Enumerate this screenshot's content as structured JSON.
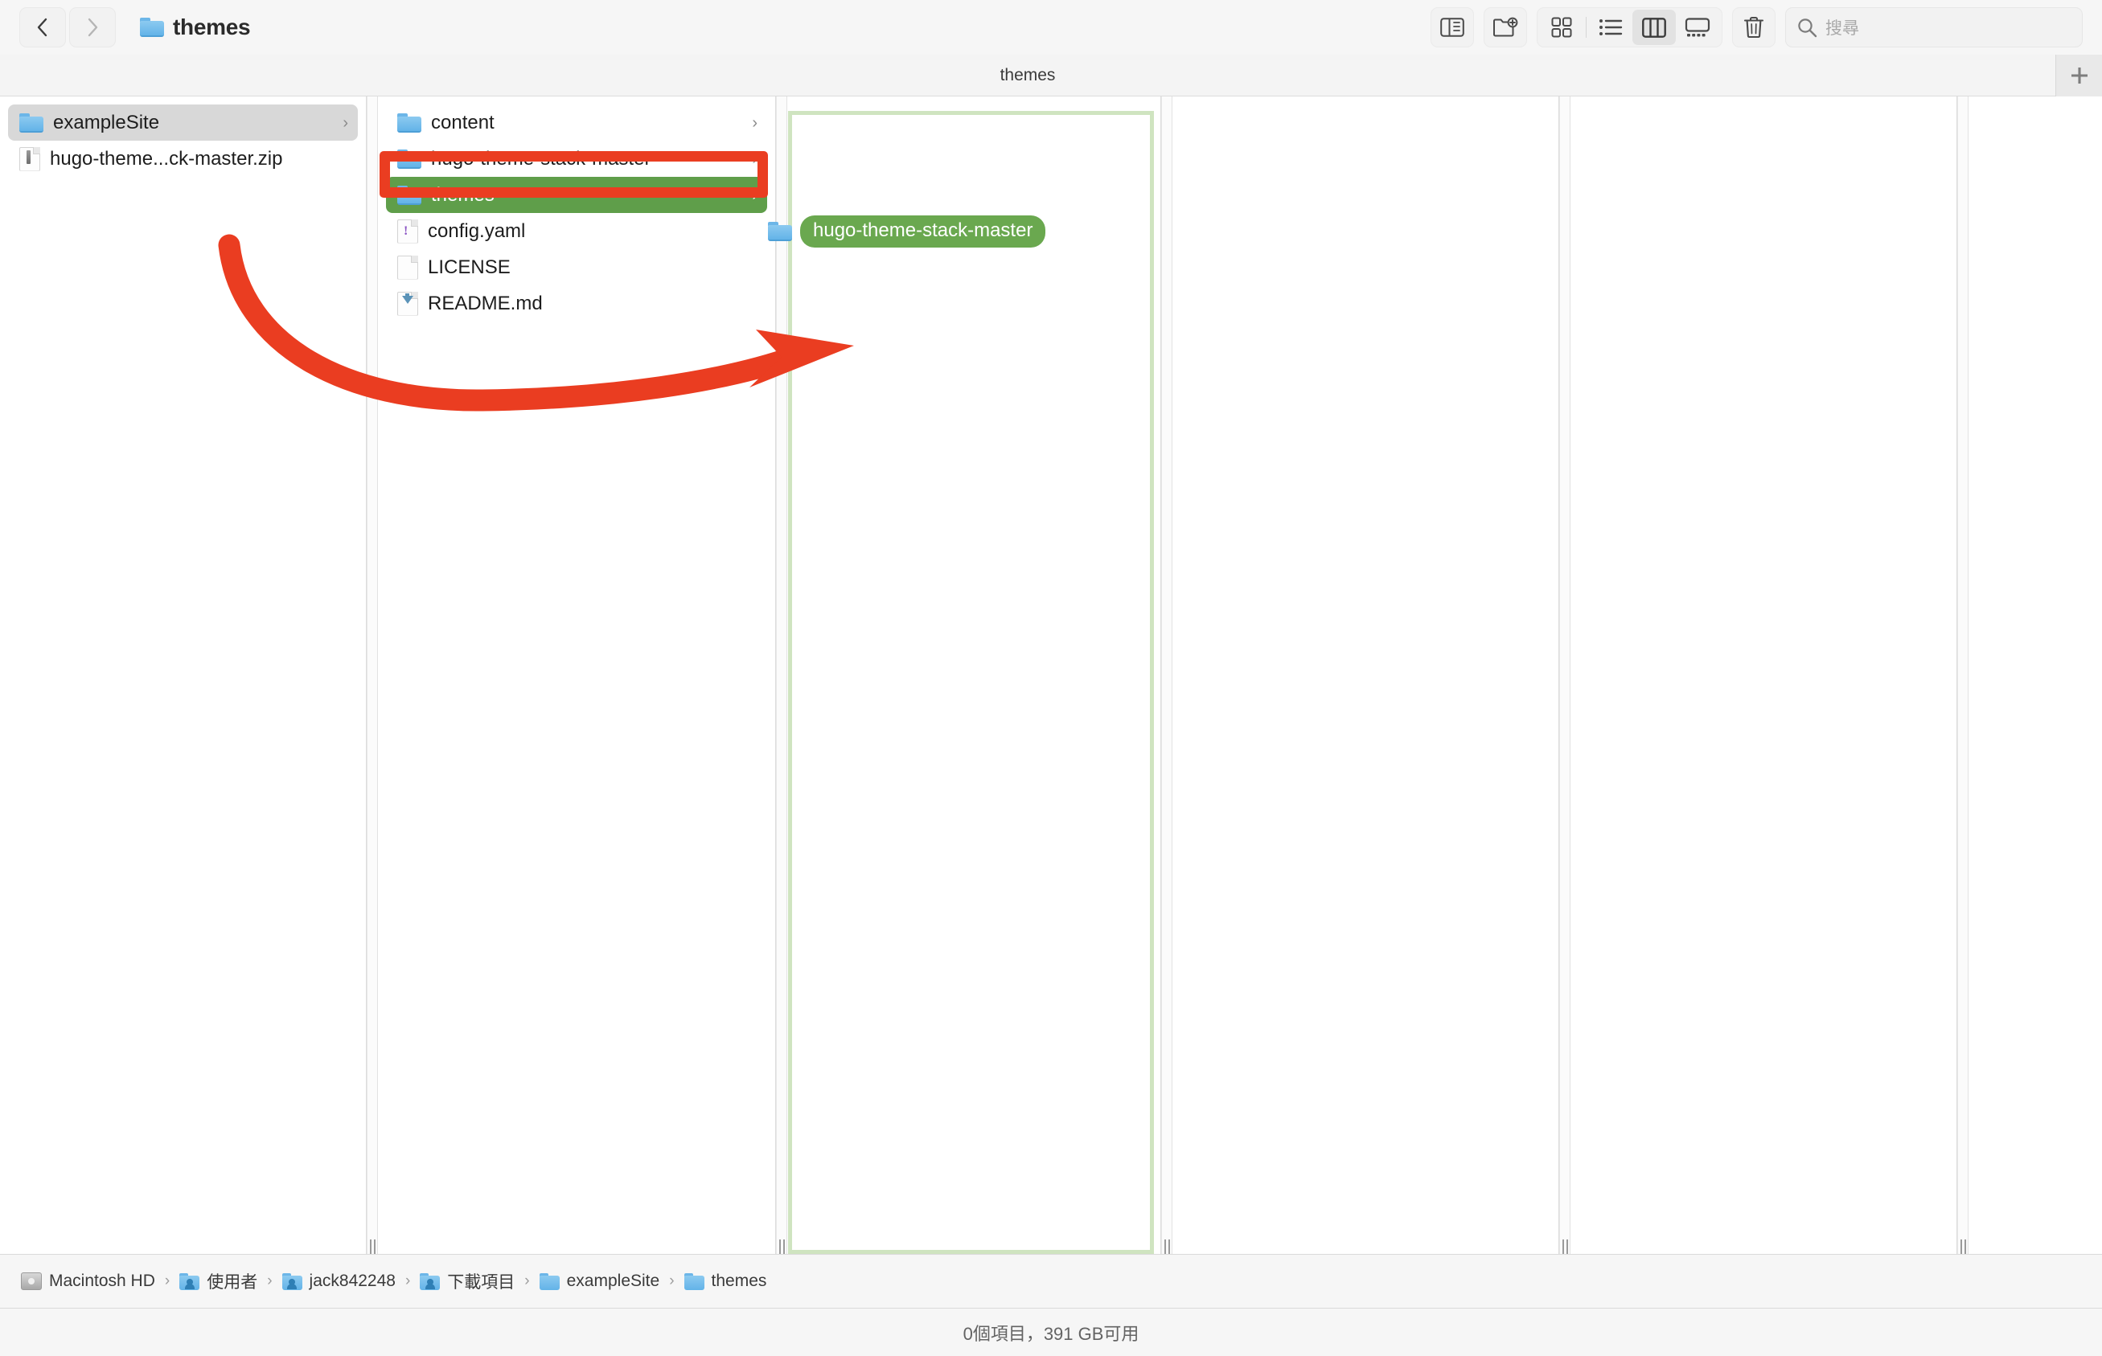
{
  "window": {
    "title": "themes",
    "tab_label": "themes"
  },
  "toolbar": {
    "back_icon": "chevron-left-icon",
    "forward_icon": "chevron-right-icon",
    "sidebar_toggle_icon": "sidebar-toggle-icon",
    "new_folder_icon": "new-folder-icon",
    "view_icon_grid": "icon-view-icon",
    "view_list": "list-view-icon",
    "view_column": "column-view-icon",
    "view_gallery": "gallery-view-icon",
    "trash_icon": "trash-icon",
    "active_view": "column",
    "new_tab_label": "+"
  },
  "search": {
    "placeholder": "搜尋",
    "value": "",
    "icon": "search-icon"
  },
  "sidebar": {
    "items": [
      {
        "label": "exampleSite",
        "icon": "folder-icon",
        "selected": true,
        "disclosure": "›"
      },
      {
        "label": "hugo-theme...ck-master.zip",
        "icon": "zip-file-icon",
        "selected": false,
        "disclosure": ""
      }
    ]
  },
  "column2": {
    "items": [
      {
        "label": "content",
        "icon": "folder-icon",
        "state": "normal",
        "disclosure": "›"
      },
      {
        "label": "hugo-theme-stack-master",
        "icon": "folder-icon",
        "state": "annotated",
        "disclosure": "›"
      },
      {
        "label": "themes",
        "icon": "folder-icon",
        "state": "droptarget",
        "disclosure": "›"
      },
      {
        "label": "config.yaml",
        "icon": "yaml-file-icon",
        "state": "normal",
        "disclosure": ""
      },
      {
        "label": "LICENSE",
        "icon": "generic-file-icon",
        "state": "normal",
        "disclosure": ""
      },
      {
        "label": "README.md",
        "icon": "markdown-file-icon",
        "state": "normal",
        "disclosure": ""
      }
    ]
  },
  "drag": {
    "ghost_label": "hugo-theme-stack-master",
    "ghost_icon": "folder-icon"
  },
  "pathbar": {
    "crumbs": [
      {
        "label": "Macintosh HD",
        "icon": "harddisk-icon"
      },
      {
        "label": "使用者",
        "icon": "users-folder-icon"
      },
      {
        "label": "jack842248",
        "icon": "home-folder-icon"
      },
      {
        "label": "下載項目",
        "icon": "downloads-folder-icon"
      },
      {
        "label": "exampleSite",
        "icon": "folder-icon"
      },
      {
        "label": "themes",
        "icon": "folder-icon"
      }
    ],
    "separator": "›"
  },
  "statusbar": {
    "text": "0個項目，391 GB可用"
  },
  "colors": {
    "selection_green": "#5f9e4a",
    "ghost_green": "#6aa84f",
    "droptarget_border": "#cfe4c0",
    "annotation_red": "#ea3d21",
    "sidebar_selection_gray": "#d8d8d8"
  }
}
